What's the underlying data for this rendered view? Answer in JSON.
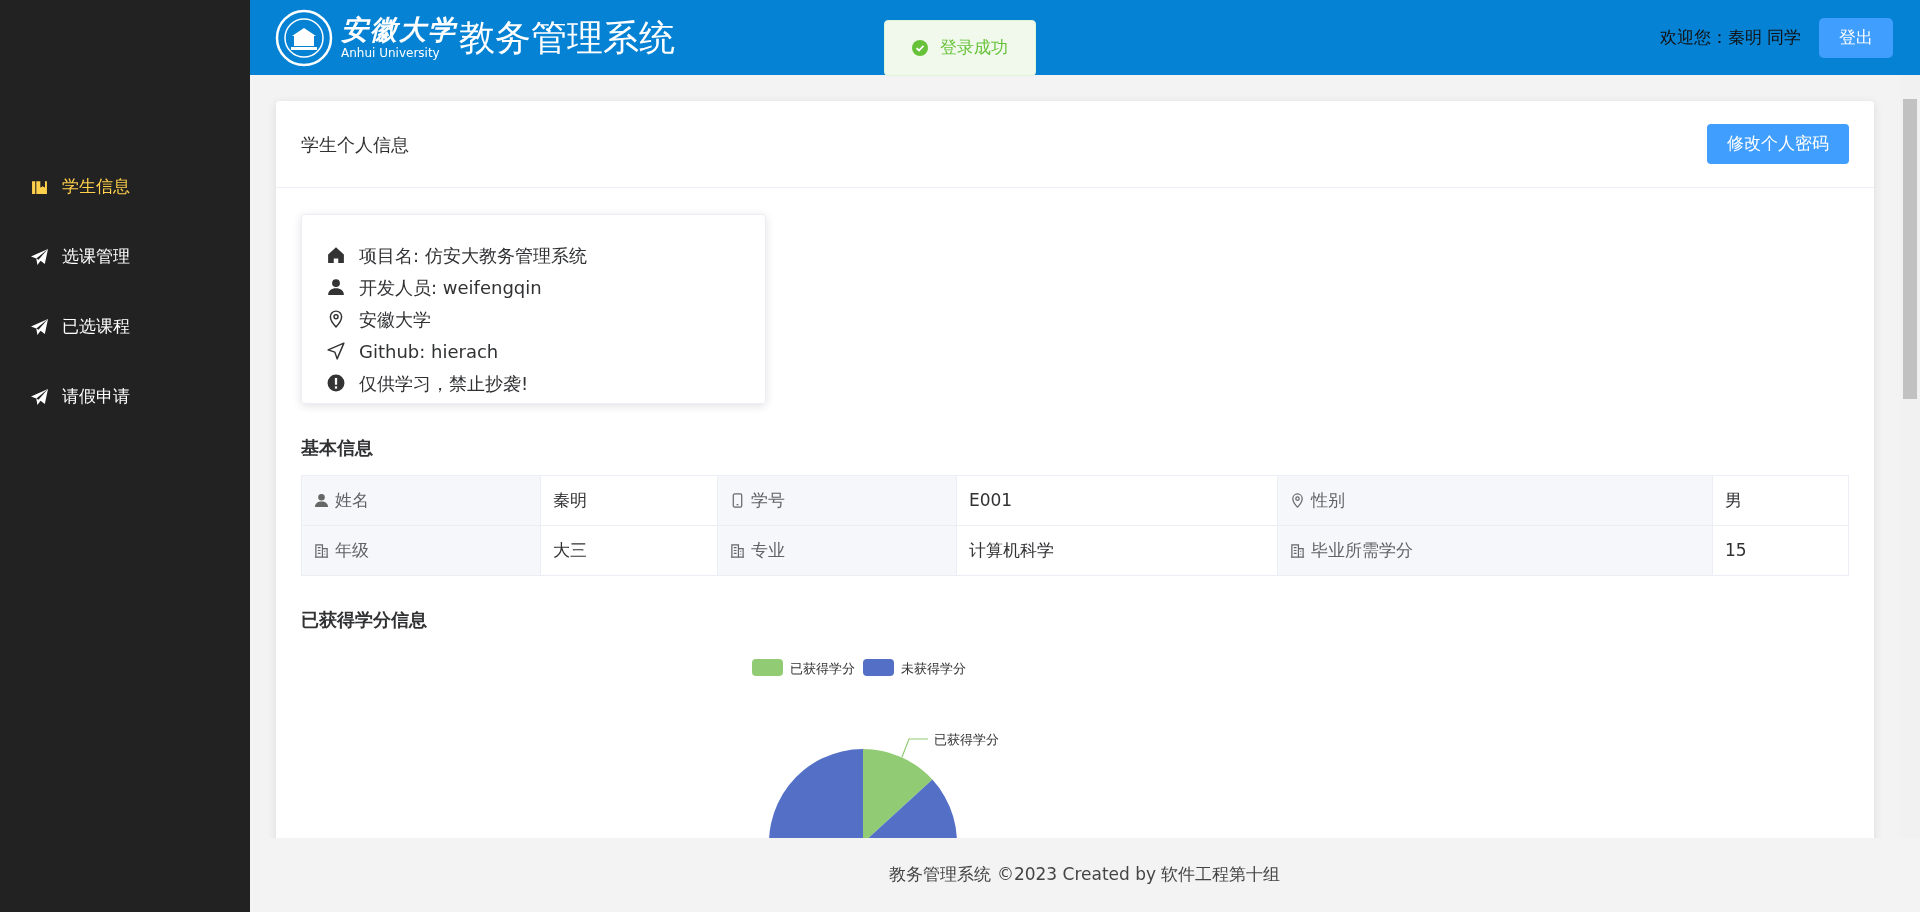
{
  "sidebar": {
    "items": [
      {
        "label": "学生信息",
        "selected": true,
        "kind": "book"
      },
      {
        "label": "选课管理",
        "selected": false,
        "kind": "plane"
      },
      {
        "label": "已选课程",
        "selected": false,
        "kind": "plane"
      },
      {
        "label": "请假申请",
        "selected": false,
        "kind": "plane"
      }
    ]
  },
  "header": {
    "logo_text": "安徽大学",
    "logo_subtext": "Anhui University",
    "title": "教务管理系统",
    "welcome": "欢迎您：秦明 同学",
    "logout": "登出"
  },
  "toast": {
    "kind": "success",
    "message": "登录成功"
  },
  "panel": {
    "title": "学生个人信息",
    "button": "修改个人密码"
  },
  "about": [
    {
      "kind": "home",
      "text": "项目名: 仿安大教务管理系统"
    },
    {
      "kind": "user",
      "text": "开发人员: weifengqin"
    },
    {
      "kind": "pin",
      "text": "安徽大学"
    },
    {
      "kind": "send",
      "text": "Github: hierach"
    },
    {
      "kind": "alert",
      "text": "仅供学习，禁止抄袭!"
    }
  ],
  "basic_info": {
    "title": "基本信息",
    "rows": [
      [
        {
          "kind": "user",
          "label": "姓名",
          "value": "秦明"
        },
        {
          "kind": "phone",
          "label": "学号",
          "value": "E001"
        },
        {
          "kind": "pin",
          "label": "性别",
          "value": "男"
        }
      ],
      [
        {
          "kind": "building",
          "label": "年级",
          "value": "大三"
        },
        {
          "kind": "building",
          "label": "专业",
          "value": "计算机科学"
        },
        {
          "kind": "building",
          "label": "毕业所需学分",
          "value": "15"
        }
      ]
    ]
  },
  "credits": {
    "title": "已获得学分信息",
    "legend": [
      {
        "label": "已获得学分",
        "color": "#91cc75"
      },
      {
        "label": "未获得学分",
        "color": "#5470c6"
      }
    ],
    "slice_label": "已获得学分"
  },
  "footer": "教务管理系统 ©2023 Created by 软件工程第十组"
}
